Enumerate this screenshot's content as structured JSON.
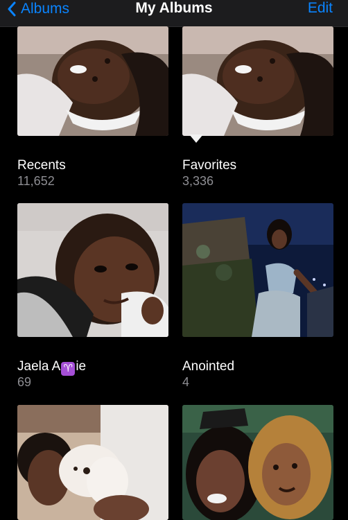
{
  "nav": {
    "back_label": "Albums",
    "title": "My Albums",
    "edit_label": "Edit"
  },
  "albums": [
    {
      "title": "Recents",
      "count": "11,652",
      "photo": "selfie-headband"
    },
    {
      "title": "Favorites",
      "count": "3,336",
      "photo": "selfie-headband"
    },
    {
      "title_before": "Jaela A",
      "title_emoji": "♈",
      "title_after": "ie",
      "count": "69",
      "photo": "selfie-close-up"
    },
    {
      "title": "Anointed",
      "count": "4",
      "photo": "night-pose"
    },
    {
      "photo": "person-with-dog"
    },
    {
      "photo": "two-friends-selfie"
    }
  ],
  "colors": {
    "accent": "#0a84ff",
    "background": "#000000",
    "navbar": "#1c1c1e",
    "secondary_text": "#8e8e93",
    "aries_badge": "#a54fd6"
  }
}
